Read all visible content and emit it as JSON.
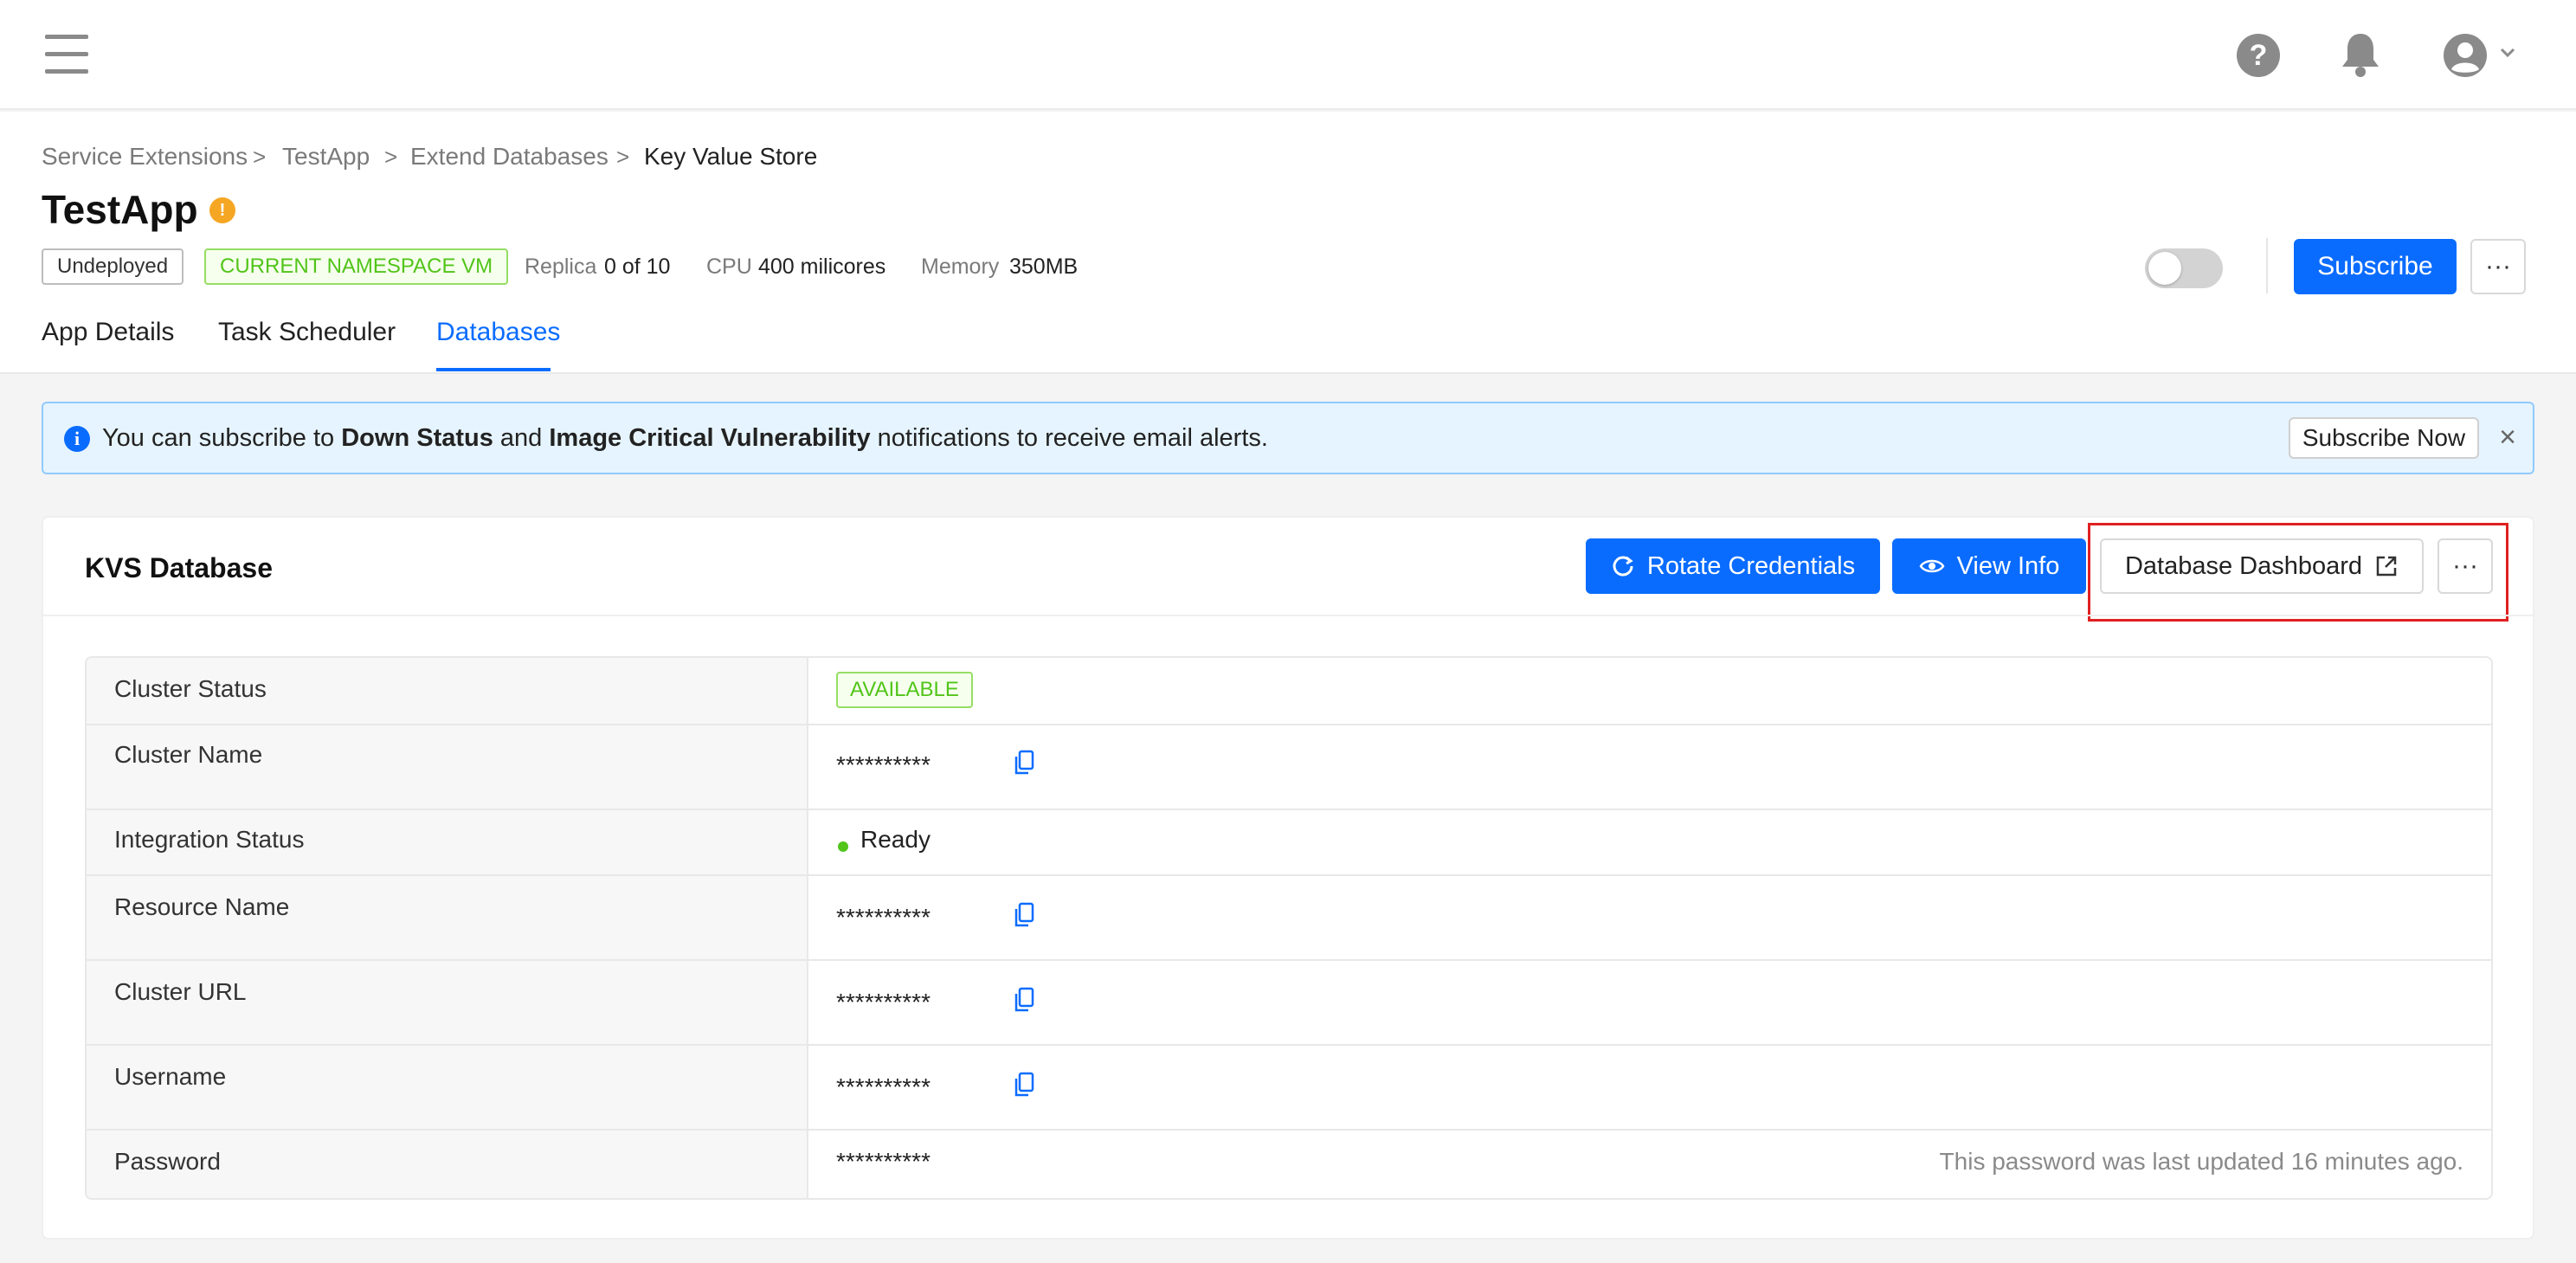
{
  "topbar": {
    "menu_icon": "hamburger-icon",
    "help_icon": "question-icon",
    "help_glyph": "?",
    "bell_icon": "bell-icon",
    "avatar_icon": "user-avatar-icon",
    "chevron_icon": "chevron-down-icon"
  },
  "breadcrumb": {
    "items": [
      "Service Extensions",
      "TestApp",
      "Extend Databases",
      "Key Value Store"
    ],
    "separator": ">"
  },
  "app": {
    "title": "TestApp",
    "info_glyph": "!",
    "status_tag": "Undeployed",
    "namespace_tag": "CURRENT NAMESPACE VM",
    "replica_label": "Replica",
    "replica_value": "0 of 10",
    "cpu_label": "CPU",
    "cpu_value": "400 milicores",
    "memory_label": "Memory",
    "memory_value": "350MB",
    "toggle_on": false,
    "subscribe_label": "Subscribe",
    "more_label": "···"
  },
  "tabs": [
    {
      "label": "App Details",
      "active": false
    },
    {
      "label": "Task Scheduler",
      "active": false
    },
    {
      "label": "Databases",
      "active": true
    }
  ],
  "alert": {
    "info_glyph": "i",
    "text_1": "You can subscribe to ",
    "bold_1": "Down Status",
    "text_2": " and ",
    "bold_2": "Image Critical Vulnerability",
    "text_3": " notifications to receive email alerts.",
    "button_label": "Subscribe Now",
    "close_glyph": "×"
  },
  "card": {
    "title": "KVS Database",
    "rotate_label": "Rotate Credentials",
    "view_label": "View Info",
    "dashboard_label": "Database Dashboard",
    "more_label": "···"
  },
  "table": {
    "rows": [
      {
        "label": "Cluster Status",
        "value": "AVAILABLE"
      },
      {
        "label": "Cluster Name",
        "value": "**********"
      },
      {
        "label": "Integration Status",
        "value": "Ready"
      },
      {
        "label": "Resource Name",
        "value": "**********"
      },
      {
        "label": "Cluster URL",
        "value": "**********"
      },
      {
        "label": "Username",
        "value": "**********"
      },
      {
        "label": "Password",
        "value": "**********",
        "note": "This password was last updated 16 minutes ago."
      }
    ]
  },
  "colors": {
    "primary": "#0a6cff",
    "success": "#52c41a",
    "warning": "#f5a623",
    "highlight": "#e02020"
  }
}
